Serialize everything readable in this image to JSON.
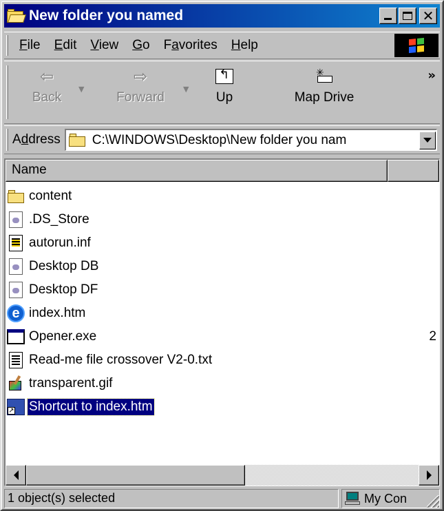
{
  "window": {
    "title": "New folder you named"
  },
  "menu": {
    "items": [
      {
        "label": "File",
        "key": "F",
        "rest": "ile"
      },
      {
        "label": "Edit",
        "key": "E",
        "rest": "dit"
      },
      {
        "label": "View",
        "key": "V",
        "rest": "iew"
      },
      {
        "label": "Go",
        "key": "G",
        "rest": "o"
      },
      {
        "label": "Favorites",
        "pre": "F",
        "key": "a",
        "rest": "vorites"
      },
      {
        "label": "Help",
        "key": "H",
        "rest": "elp"
      }
    ]
  },
  "toolbar": {
    "back_label": "Back",
    "forward_label": "Forward",
    "up_label": "Up",
    "map_drive_label": "Map Drive",
    "more": "»"
  },
  "address": {
    "label_pre": "A",
    "label_key": "d",
    "label_rest": "dress",
    "value": "C:\\WINDOWS\\Desktop\\New folder you nam"
  },
  "list": {
    "columns": [
      "Name",
      ""
    ],
    "rows": [
      {
        "name": "content",
        "icon": "folder-icon",
        "size": ""
      },
      {
        "name": ".DS_Store",
        "icon": "document-icon",
        "size": ""
      },
      {
        "name": "autorun.inf",
        "icon": "setup-info-icon",
        "size": ""
      },
      {
        "name": "Desktop DB",
        "icon": "document-icon",
        "size": ""
      },
      {
        "name": "Desktop DF",
        "icon": "document-icon",
        "size": ""
      },
      {
        "name": "index.htm",
        "icon": "internet-explorer-icon",
        "size": ""
      },
      {
        "name": "Opener.exe",
        "icon": "application-icon",
        "size": "2"
      },
      {
        "name": "Read-me file crossover V2-0.txt",
        "icon": "text-file-icon",
        "size": ""
      },
      {
        "name": "transparent.gif",
        "icon": "image-file-icon",
        "size": ""
      },
      {
        "name": "Shortcut to index.htm",
        "icon": "shortcut-icon",
        "size": "",
        "selected": true
      }
    ]
  },
  "status": {
    "selection": "1 object(s) selected",
    "zone": "My Con"
  },
  "colors": {
    "title_start": "#000080",
    "title_end": "#1084d0",
    "face": "#c0c0c0",
    "selection": "#000080"
  }
}
